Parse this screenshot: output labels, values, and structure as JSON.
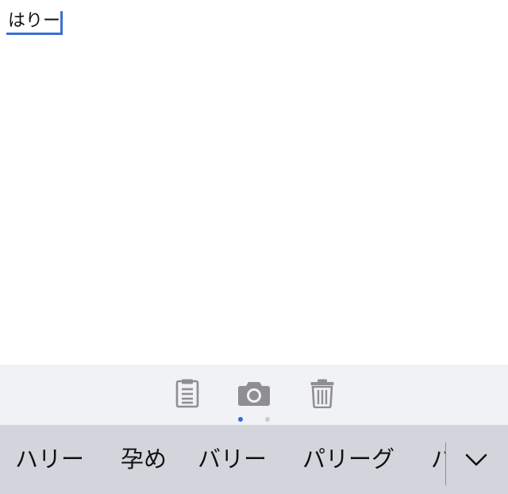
{
  "editor": {
    "composing_text": "はりー"
  },
  "toolbar": {
    "buttons": [
      {
        "name": "clipboard-button",
        "icon": "clipboard-icon"
      },
      {
        "name": "camera-button",
        "icon": "camera-icon"
      },
      {
        "name": "trash-button",
        "icon": "trash-icon"
      }
    ],
    "pager": {
      "pages": 2,
      "active_page": 1,
      "active_color": "#2f6bd9",
      "inactive_color": "#c9cbd1"
    }
  },
  "candidates": {
    "items": [
      "ハリー",
      "孕め",
      "バリー",
      "パリーグ",
      "パ"
    ],
    "expand_icon": "chevron-down-icon"
  },
  "colors": {
    "accent": "#3b6fd4",
    "toolbar_bg": "#f1f2f6",
    "candidate_bg": "#d2d5db",
    "icon_gray": "#8e8e93"
  }
}
